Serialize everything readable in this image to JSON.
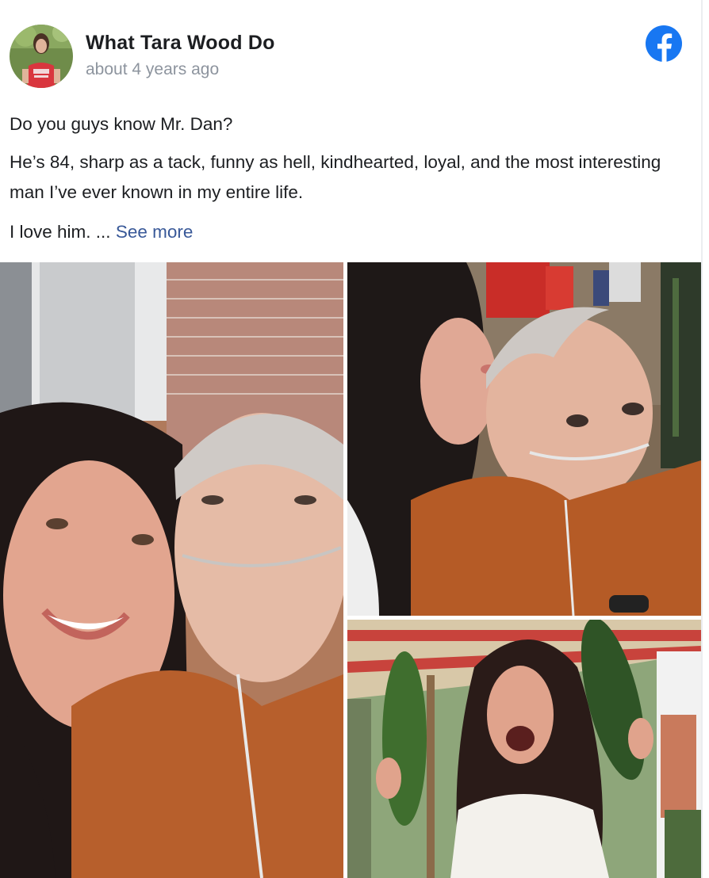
{
  "post": {
    "author": "What Tara Wood Do",
    "timestamp": "about 4 years ago",
    "avatar_icon": "avatar-photo",
    "platform_icon": "facebook-icon",
    "brand_color": "#1877f2",
    "paragraphs": [
      "Do you guys know Mr. Dan?",
      "He’s 84, sharp as a tack, funny as hell, kindhearted, loyal, and the most interesting man I’ve ever known in my entire life.",
      "I love him. ..."
    ],
    "see_more_label": "See more",
    "link_color": "#385898"
  },
  "photos": [
    {
      "name": "selfie-with-mr-dan"
    },
    {
      "name": "kiss-on-forehead"
    },
    {
      "name": "holding-giant-zucchinis"
    }
  ]
}
